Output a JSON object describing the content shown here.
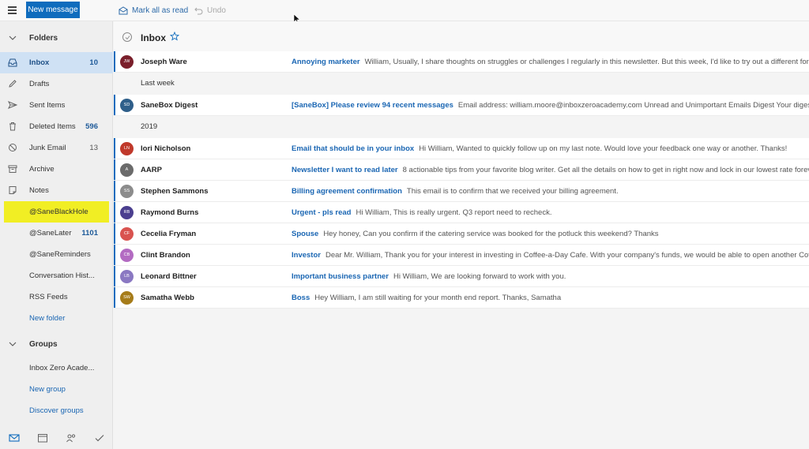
{
  "toolbar": {
    "new_message": "New message",
    "mark_all_read": "Mark all as read",
    "undo": "Undo"
  },
  "sidebar": {
    "folders_header": "Folders",
    "folders": [
      {
        "label": "Inbox",
        "count": "10",
        "icon": "inbox-icon"
      },
      {
        "label": "Drafts",
        "count": "",
        "icon": "pencil-icon"
      },
      {
        "label": "Sent Items",
        "count": "",
        "icon": "send-icon"
      },
      {
        "label": "Deleted Items",
        "count": "596",
        "icon": "trash-icon"
      },
      {
        "label": "Junk Email",
        "count": "13",
        "icon": "block-icon"
      },
      {
        "label": "Archive",
        "count": "",
        "icon": "archive-icon"
      },
      {
        "label": "Notes",
        "count": "",
        "icon": "note-icon"
      },
      {
        "label": "@SaneBlackHole",
        "count": ""
      },
      {
        "label": "@SaneLater",
        "count": "1101"
      },
      {
        "label": "@SaneReminders",
        "count": ""
      },
      {
        "label": "Conversation Hist...",
        "count": ""
      },
      {
        "label": "RSS Feeds",
        "count": ""
      },
      {
        "label": "New folder",
        "count": ""
      }
    ],
    "groups_header": "Groups",
    "groups": [
      {
        "label": "Inbox Zero Acade..."
      },
      {
        "label": "New group"
      },
      {
        "label": "Discover groups"
      }
    ],
    "highlight_color": "#f1ee24",
    "accent_color": "#0f6cbd"
  },
  "list": {
    "title": "Inbox",
    "group_labels": [
      "Last week",
      "2019"
    ],
    "emails": [
      {
        "initials": "JW",
        "avatar_color": "#7a1f2b",
        "sender": "Joseph Ware",
        "subject": "Annoying marketer",
        "snippet": "William, Usually, I share thoughts on struggles or challenges I regularly in this newsletter. But this week, I'd like to try out a different format"
      },
      {
        "initials": "SD",
        "avatar_color": "#2f5f8a",
        "sender": "SaneBox Digest",
        "subject": "[SaneBox] Please review 94 recent messages",
        "snippet": "Email address: william.moore@inboxzeroacademy.com Unread and Unimportant Emails Digest Your digest is ready"
      },
      {
        "initials": "LN",
        "avatar_color": "#c0392b",
        "sender": "lori Nicholson",
        "subject": "Email that should be in your inbox",
        "snippet": "Hi William, Wanted to quickly follow up on my last note. Would love your feedback one way or another. Thanks!"
      },
      {
        "initials": "A",
        "avatar_color": "#6b6b6b",
        "sender": "AARP",
        "subject": "Newsletter I want to read later",
        "snippet": "8 actionable tips from your favorite blog writer. Get all the details on how to get in right now and lock in our lowest rate forever"
      },
      {
        "initials": "SS",
        "avatar_color": "#8c8c8c",
        "sender": "Stephen Sammons",
        "subject": "Billing agreement confirmation",
        "snippet": "This email is to confirm that we received your billing agreement."
      },
      {
        "initials": "RB",
        "avatar_color": "#4b3f8f",
        "sender": "Raymond Burns",
        "subject": "Urgent - pls read",
        "snippet": "Hi William, This is really urgent. Q3 report need to recheck."
      },
      {
        "initials": "CF",
        "avatar_color": "#d9534f",
        "sender": "Cecelia Fryman",
        "subject": "Spouse",
        "snippet": "Hey honey, Can you confirm if the catering service was booked for the potluck this weekend? Thanks"
      },
      {
        "initials": "CB",
        "avatar_color": "#b36bc2",
        "sender": "Clint Brandon",
        "subject": "Investor",
        "snippet": "Dear Mr. William, Thank you for your interest in investing in Coffee-a-Day Cafe. With your company's funds, we would be able to open another Coffee"
      },
      {
        "initials": "LB",
        "avatar_color": "#8a78c2",
        "sender": "Leonard Bittner",
        "subject": "Important business partner",
        "snippet": "Hi William, We are looking forward to work with you."
      },
      {
        "initials": "SW",
        "avatar_color": "#a67c1a",
        "sender": "Samatha Webb",
        "subject": "Boss",
        "snippet": "Hey William, I am still waiting for your month end report. Thanks, Samatha"
      }
    ]
  },
  "bottom_nav": [
    "mail-icon",
    "calendar-icon",
    "people-icon",
    "tasks-icon"
  ]
}
